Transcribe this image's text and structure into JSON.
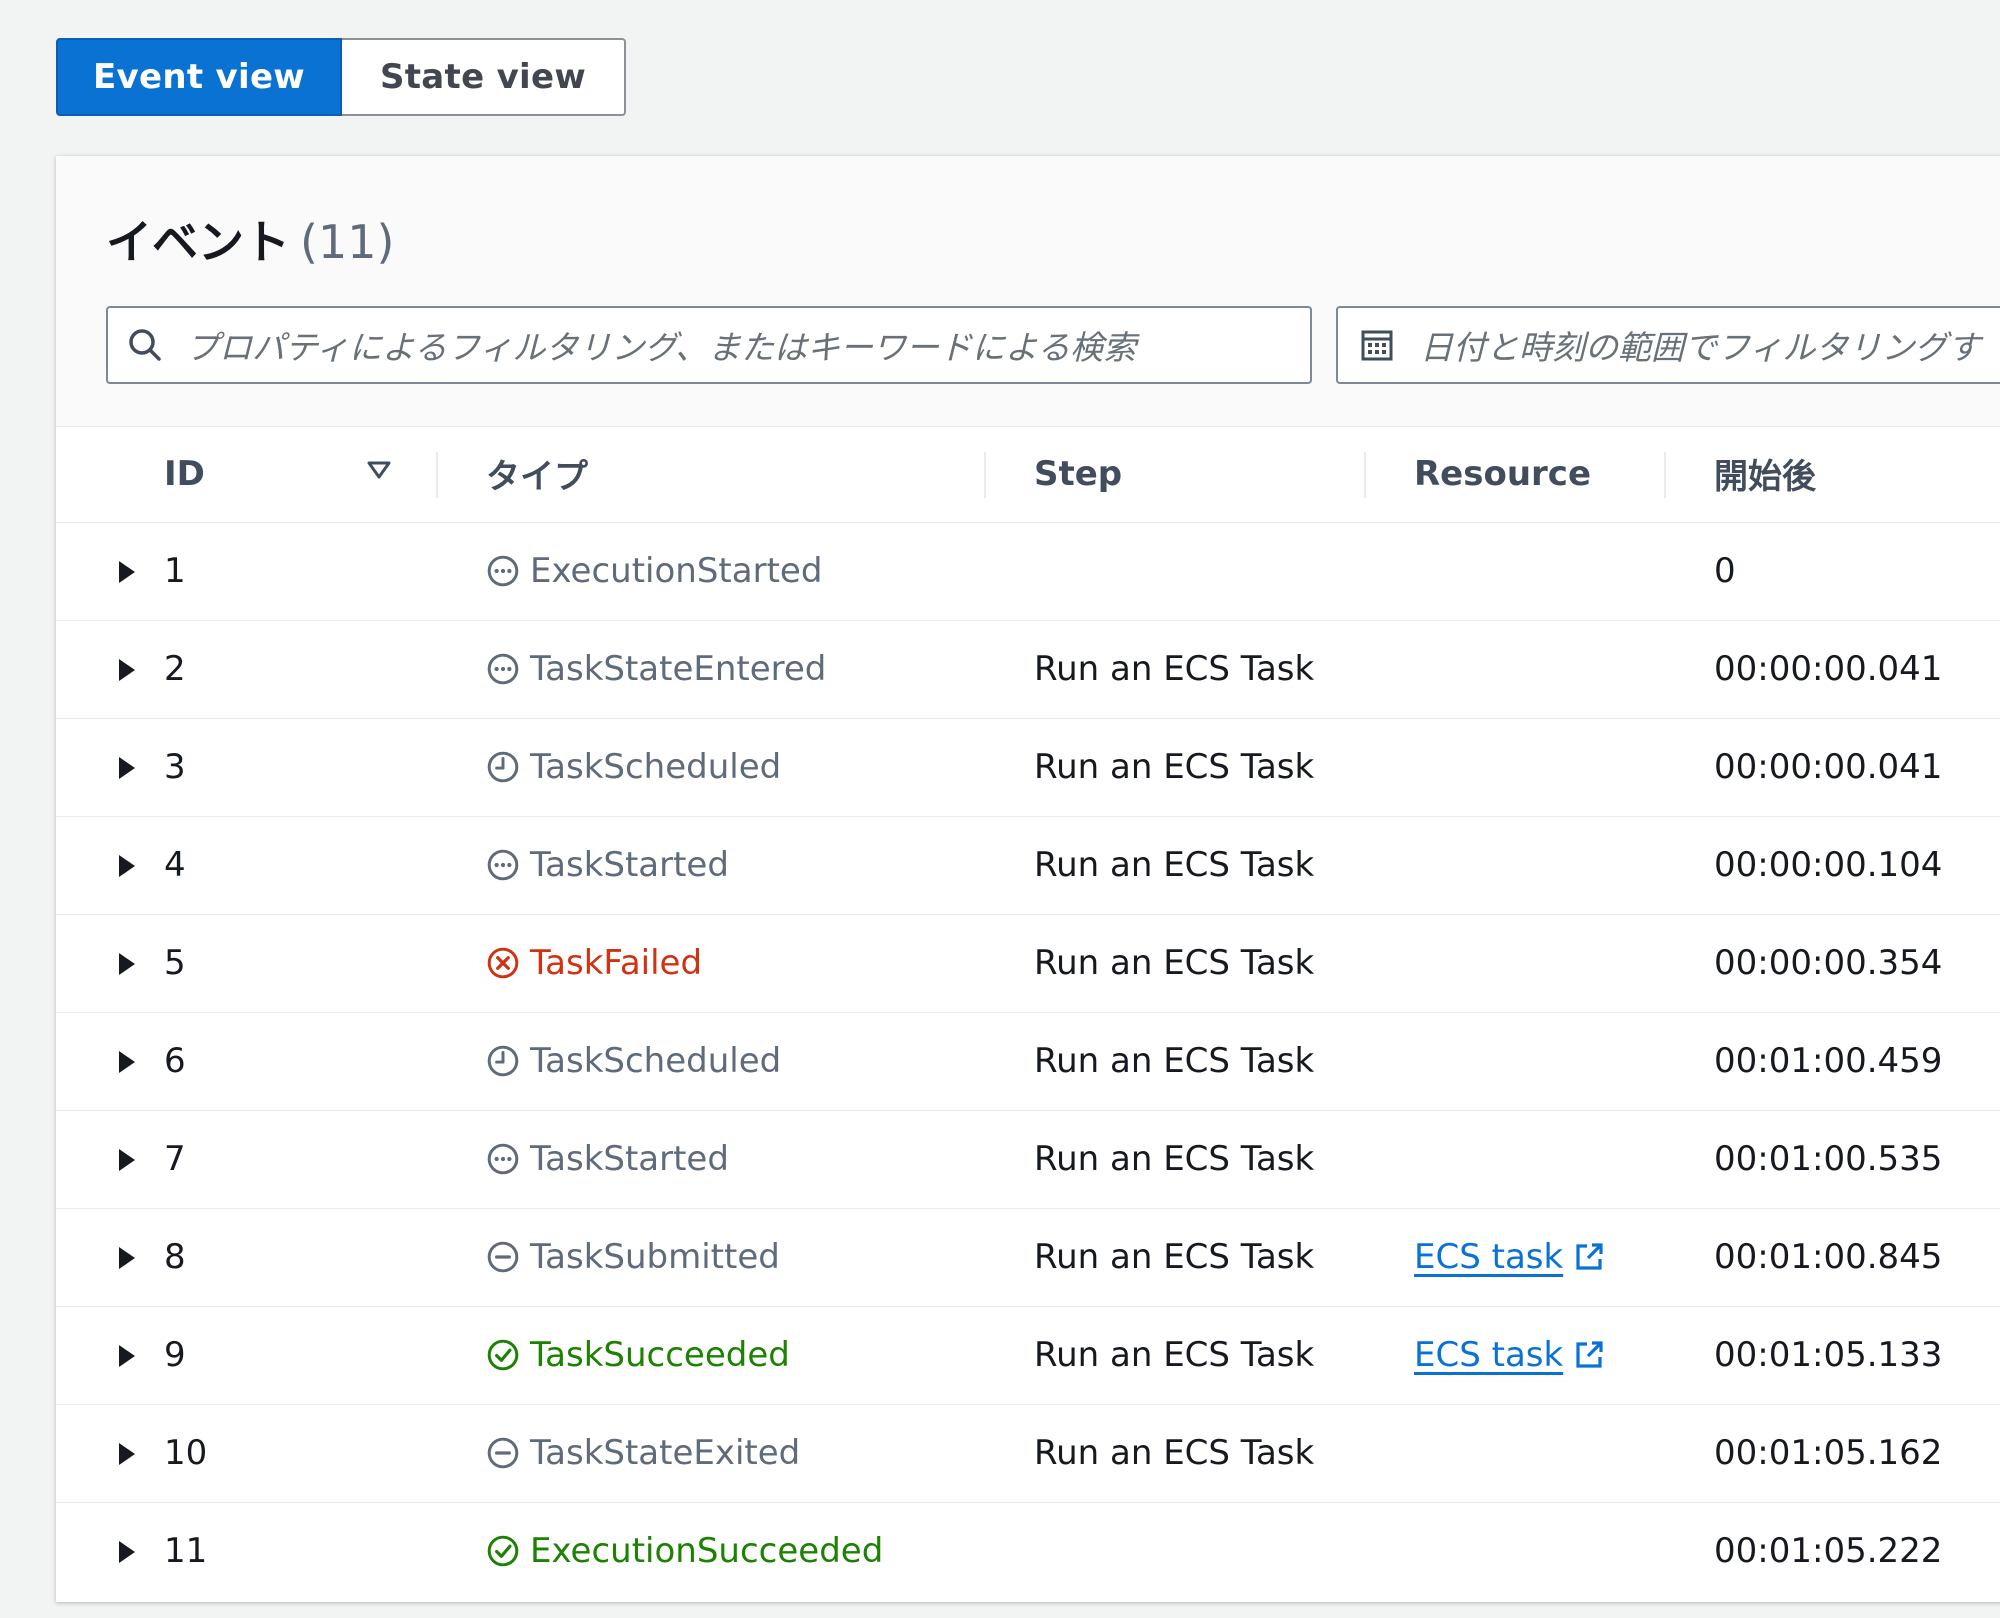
{
  "view_toggle": {
    "event_view": "Event view",
    "state_view": "State view"
  },
  "events_panel": {
    "title": "イベント",
    "count": "(11)",
    "search_placeholder": "プロパティによるフィルタリング、またはキーワードによる検索",
    "date_placeholder": "日付と時刻の範囲でフィルタリングす"
  },
  "table": {
    "columns": {
      "id": "ID",
      "type": "タイプ",
      "step": "Step",
      "resource": "Resource",
      "started_after": "開始後"
    },
    "rows": [
      {
        "id": "1",
        "type": "ExecutionStarted",
        "status": "neutral",
        "icon": "in-progress-icon",
        "step": "",
        "resource": "",
        "started_after": "0"
      },
      {
        "id": "2",
        "type": "TaskStateEntered",
        "status": "neutral",
        "icon": "in-progress-icon",
        "step": "Run an ECS Task",
        "resource": "",
        "started_after": "00:00:00.041"
      },
      {
        "id": "3",
        "type": "TaskScheduled",
        "status": "neutral",
        "icon": "clock-icon",
        "step": "Run an ECS Task",
        "resource": "",
        "started_after": "00:00:00.041"
      },
      {
        "id": "4",
        "type": "TaskStarted",
        "status": "neutral",
        "icon": "in-progress-icon",
        "step": "Run an ECS Task",
        "resource": "",
        "started_after": "00:00:00.104"
      },
      {
        "id": "5",
        "type": "TaskFailed",
        "status": "error",
        "icon": "error-icon",
        "step": "Run an ECS Task",
        "resource": "",
        "started_after": "00:00:00.354"
      },
      {
        "id": "6",
        "type": "TaskScheduled",
        "status": "neutral",
        "icon": "clock-icon",
        "step": "Run an ECS Task",
        "resource": "",
        "started_after": "00:01:00.459"
      },
      {
        "id": "7",
        "type": "TaskStarted",
        "status": "neutral",
        "icon": "in-progress-icon",
        "step": "Run an ECS Task",
        "resource": "",
        "started_after": "00:01:00.535"
      },
      {
        "id": "8",
        "type": "TaskSubmitted",
        "status": "neutral",
        "icon": "stopped-icon",
        "step": "Run an ECS Task",
        "resource": "ECS task",
        "started_after": "00:01:00.845"
      },
      {
        "id": "9",
        "type": "TaskSucceeded",
        "status": "success",
        "icon": "success-icon",
        "step": "Run an ECS Task",
        "resource": "ECS task",
        "started_after": "00:01:05.133"
      },
      {
        "id": "10",
        "type": "TaskStateExited",
        "status": "neutral",
        "icon": "stopped-icon",
        "step": "Run an ECS Task",
        "resource": "",
        "started_after": "00:01:05.162"
      },
      {
        "id": "11",
        "type": "ExecutionSucceeded",
        "status": "success",
        "icon": "success-icon",
        "step": "",
        "resource": "",
        "started_after": "00:01:05.222"
      }
    ]
  },
  "colors": {
    "primary": "#0972d3",
    "neutral_status": "#5f6b7a",
    "error_status": "#d13212",
    "success_status": "#1d8102"
  }
}
